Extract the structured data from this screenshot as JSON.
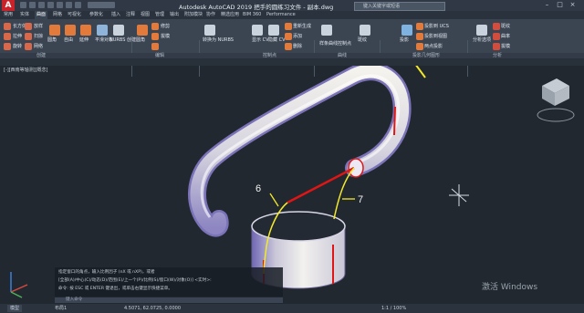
{
  "window": {
    "title": "Autodesk AutoCAD 2019   把手的圆练习文件 - 副本.dwg",
    "search_placeholder": "键入关键字或短语"
  },
  "ribbon_tabs": [
    "常用",
    "实体",
    "曲面",
    "网格",
    "可视化",
    "参数化",
    "插入",
    "注释",
    "视图",
    "管理",
    "输出",
    "附加模块",
    "协作",
    "精选应用",
    "BIM 360",
    "Performance"
  ],
  "ribbon_buttons": {
    "box": "长方体",
    "extrude": "拉伸",
    "smooth": "平滑对象",
    "free": "自由",
    "nurbs_create": "NURBS 创建",
    "loft": "放样",
    "sweep": "扫掠",
    "revolve": "旋转",
    "network": "网络",
    "blend": "圆角",
    "fillet": "圆角",
    "extend": "延伸",
    "trim": "修剪",
    "curve_edit": "转换为 NURBS",
    "show_cv": "显示 CV",
    "hide_cv": "隐藏 CV",
    "rebuild": "重新生成",
    "add": "添加",
    "remove": "删除",
    "cvedit": "样条曲线控制点",
    "project": "投影",
    "to_ucs": "投影到 UCS",
    "to_view": "投影到视图",
    "two_point": "两点投影",
    "analysis": "分析选项",
    "zebra": "斑纹",
    "curvature": "曲率",
    "draft": "拔模"
  },
  "ribbon_panels": [
    "创建",
    "编辑",
    "控制点",
    "曲线",
    "投影几何图形",
    "分析"
  ],
  "doc_tab": "[-][西南等轴测][概念]",
  "annotations": [
    "6",
    "7"
  ],
  "command_history": [
    "指定窗口的角点，输入比例因子 (nX 或 nXP)，或者",
    "[全部(A)/中心(C)/动态(D)/范围(E)/上一个(P)/比例(S)/窗口(W)/对象(O)] <实时>:",
    "命令: 按 ESC 或 ENTER 键退出，或单击右键显示快捷菜单。"
  ],
  "command_prompt": "键入命令",
  "status": {
    "coords": "4.5071, 62.0725, 0.0000",
    "model": "模型",
    "scale": "1:1 / 100%",
    "layout": "布局1"
  },
  "watermark": "激活 Windows",
  "colors": {
    "accent": "#c8232b",
    "background": "#212830",
    "arrow": "#f0e62a",
    "edge": "#e01515"
  }
}
